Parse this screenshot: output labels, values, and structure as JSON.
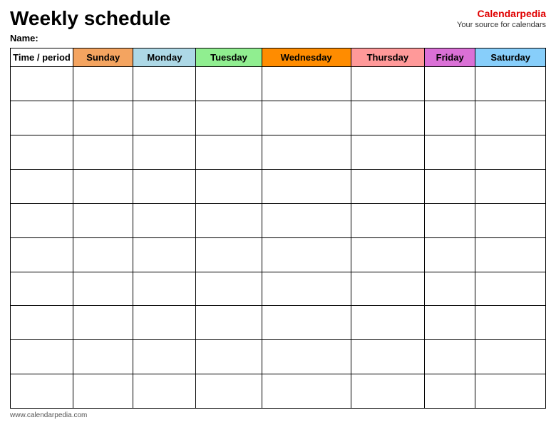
{
  "page": {
    "title": "Weekly schedule",
    "name_label": "Name:",
    "footer_text": "www.calendarpedia.com"
  },
  "brand": {
    "name_part1": "Calendar",
    "name_part2": "pedia",
    "tagline": "Your source for calendars"
  },
  "table": {
    "time_header": "Time / period",
    "days": [
      {
        "label": "Sunday",
        "class": "col-sunday"
      },
      {
        "label": "Monday",
        "class": "col-monday"
      },
      {
        "label": "Tuesday",
        "class": "col-tuesday"
      },
      {
        "label": "Wednesday",
        "class": "col-wednesday"
      },
      {
        "label": "Thursday",
        "class": "col-thursday"
      },
      {
        "label": "Friday",
        "class": "col-friday"
      },
      {
        "label": "Saturday",
        "class": "col-saturday"
      }
    ],
    "row_count": 10
  }
}
